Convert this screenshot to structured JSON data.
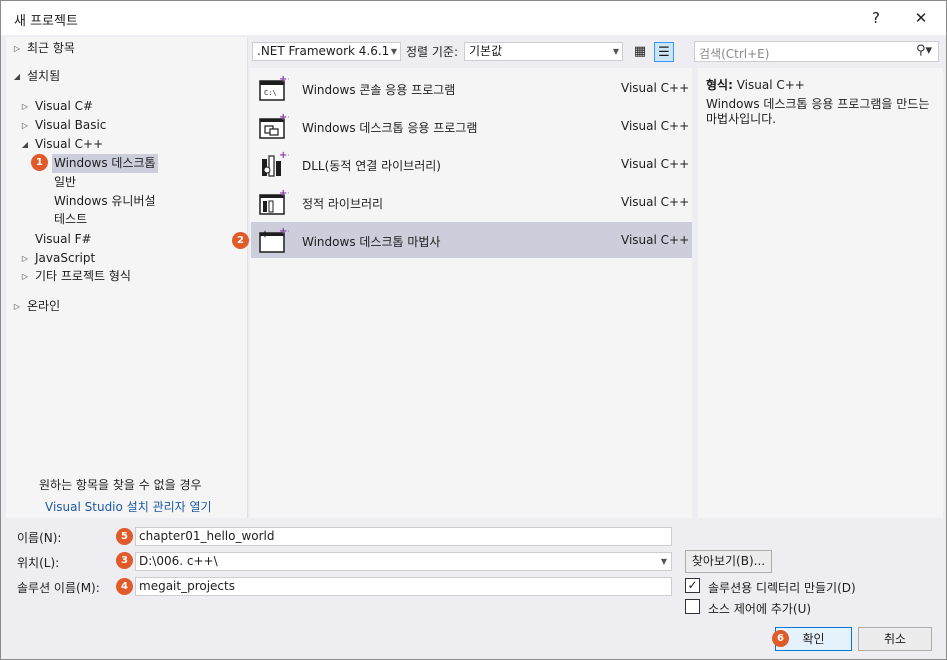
{
  "window": {
    "title": "새 프로젝트",
    "help_label": "?",
    "close_label": "✕"
  },
  "tree": [
    {
      "label": "최근 항목",
      "toggle": "▷"
    },
    {
      "label": "설치됨",
      "toggle": "◢"
    },
    {
      "label": "Visual C#",
      "toggle": "▷"
    },
    {
      "label": "Visual Basic",
      "toggle": "▷"
    },
    {
      "label": "Visual C++",
      "toggle": "◢"
    },
    {
      "label": "Windows 데스크톱",
      "toggle": ""
    },
    {
      "label": "일반",
      "toggle": ""
    },
    {
      "label": "Windows 유니버설",
      "toggle": ""
    },
    {
      "label": "테스트",
      "toggle": ""
    },
    {
      "label": "Visual F#",
      "toggle": ""
    },
    {
      "label": "JavaScript",
      "toggle": "▷"
    },
    {
      "label": "기타 프로젝트 형식",
      "toggle": "▷"
    },
    {
      "label": "온라인",
      "toggle": "▷"
    }
  ],
  "tree_footer": {
    "missing_text": "원하는 항목을 찾을 수 없을 경우",
    "installer_link": "Visual Studio 설치 관리자 열기"
  },
  "toolbar": {
    "framework": ".NET Framework 4.6.1",
    "sort_label": "정렬 기준:",
    "sort_value": "기본값",
    "search_placeholder": "검색(Ctrl+E)"
  },
  "templates": [
    {
      "name": "Windows 콘솔 응용 프로그램",
      "lang": "Visual C++",
      "icon": "console-app-icon"
    },
    {
      "name": "Windows 데스크톱 응용 프로그램",
      "lang": "Visual C++",
      "icon": "desktop-app-icon"
    },
    {
      "name": "DLL(동적 연결 라이브러리)",
      "lang": "Visual C++",
      "icon": "dll-icon"
    },
    {
      "name": "정적 라이브러리",
      "lang": "Visual C++",
      "icon": "static-library-icon"
    },
    {
      "name": "Windows 데스크톱 마법사",
      "lang": "Visual C++",
      "icon": "desktop-wizard-icon"
    }
  ],
  "description": {
    "type_label": "형식:",
    "type_value": "Visual C++",
    "text": "Windows 데스크톱 응용 프로그램을 만드는 마법사입니다."
  },
  "form": {
    "name_label": "이름(N):",
    "name_value": "chapter01_hello_world",
    "location_label": "위치(L):",
    "location_value": "D:\\006. c++\\",
    "solution_label": "솔루션 이름(M):",
    "solution_value": "megait_projects",
    "browse_label": "찾아보기(B)...",
    "create_dir_label": "솔루션용 디렉터리 만들기(D)",
    "create_dir_checked": true,
    "source_control_label": "소스 제어에 추가(U)",
    "source_control_checked": false,
    "ok_label": "확인",
    "cancel_label": "취소"
  },
  "callouts": [
    "1",
    "2",
    "3",
    "4",
    "5",
    "6"
  ],
  "colors": {
    "callout": "#e05a2a",
    "selection": "#cccedb",
    "link": "#1e5aa8",
    "accent": "#0078d7"
  }
}
